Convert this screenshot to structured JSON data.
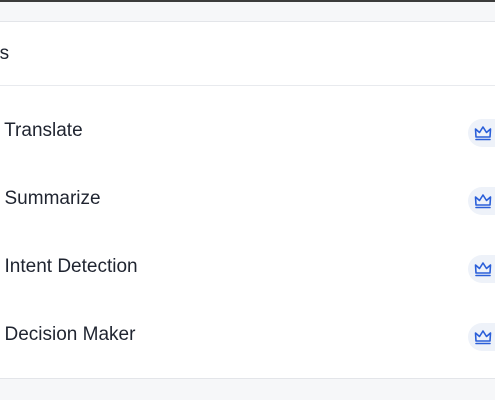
{
  "panel": {
    "title": "ns"
  },
  "items": [
    {
      "label": "l Translate",
      "badge_icon": "crown-icon"
    },
    {
      "label": "l Summarize",
      "badge_icon": "crown-icon"
    },
    {
      "label": "l Intent Detection",
      "badge_icon": "crown-icon"
    },
    {
      "label": "l Decision Maker",
      "badge_icon": "crown-icon"
    }
  ],
  "colors": {
    "accent": "#2b5fd9",
    "badge_bg": "#eef2f9",
    "text": "#1f2430",
    "border": "#e3e5e9"
  }
}
